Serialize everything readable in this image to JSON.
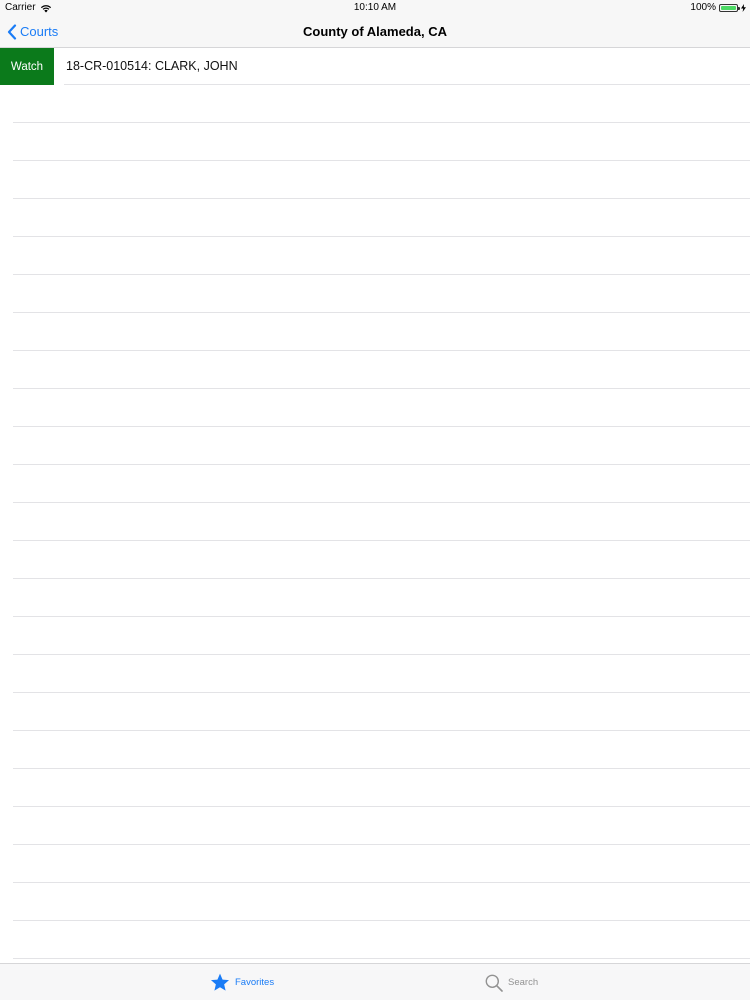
{
  "status_bar": {
    "carrier": "Carrier",
    "time": "10:10 AM",
    "battery": "100%"
  },
  "nav": {
    "back_label": "Courts",
    "title": "County of Alameda, CA"
  },
  "rows": [
    {
      "action_label": "Watch",
      "label": "18-CR-010514: CLARK, JOHN"
    }
  ],
  "tabs": [
    {
      "label": "Favorites",
      "icon": "star-icon",
      "selected": true
    },
    {
      "label": "Search",
      "icon": "search-icon",
      "selected": false
    }
  ],
  "colors": {
    "accent": "#1a7cf6",
    "watch_action": "#0b7a1b",
    "inactive_tab": "#929292"
  }
}
